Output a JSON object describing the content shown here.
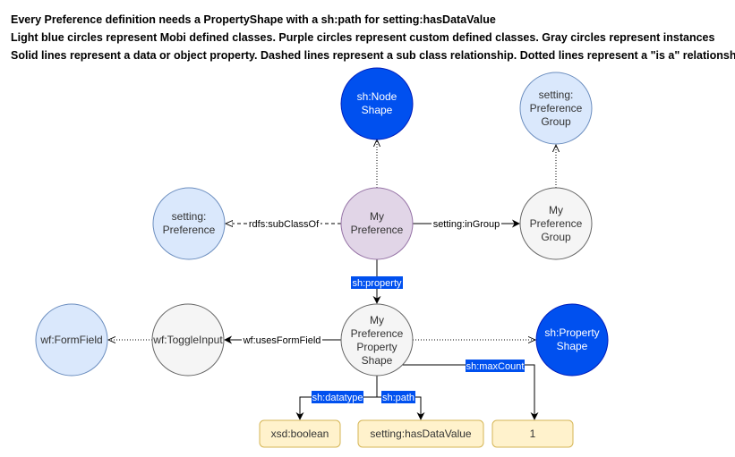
{
  "notes": [
    "Every Preference definition needs a PropertyShape with a sh:path for setting:hasDataValue",
    "Light blue circles represent Mobi defined classes. Purple circles represent custom defined classes. Gray circles represent instances",
    "Solid lines represent a data or object property. Dashed lines represent a sub class relationship. Dotted lines represent a \"is a\" relationship."
  ],
  "colors": {
    "mobi_class_fill": "#dae8fc",
    "mobi_class_stroke": "#6c8ebf",
    "custom_class_fill": "#e1d5e7",
    "custom_class_stroke": "#9673a6",
    "instance_fill": "#f5f5f5",
    "instance_stroke": "#666666",
    "shacl_fill": "#0050ef",
    "shacl_stroke": "#001dbc",
    "literal_fill": "#fff2cc",
    "literal_stroke": "#d6b656",
    "label_highlight": "#0050ef"
  },
  "nodes": {
    "node_shape": [
      "sh:Node",
      "Shape"
    ],
    "preference_group": [
      "setting:",
      "Preference",
      "Group"
    ],
    "setting_preference": [
      "setting:",
      "Preference"
    ],
    "my_preference": [
      "My",
      "Preference"
    ],
    "my_preference_group": [
      "My",
      "Preference",
      "Group"
    ],
    "form_field": [
      "wf:FormField"
    ],
    "toggle_input": [
      "wf:ToggleInput"
    ],
    "my_pref_property_shape": [
      "My",
      "Preference",
      "Property",
      "Shape"
    ],
    "property_shape": [
      "sh:Property",
      "Shape"
    ],
    "xsd_boolean": "xsd:boolean",
    "has_data_value": "setting:hasDataValue",
    "max_count_value": "1"
  },
  "edges": {
    "subclass_of": "rdfs:subClassOf",
    "in_group": "setting:inGroup",
    "property": "sh:property",
    "uses_form_field": "wf:usesFormField",
    "max_count": "sh:maxCount",
    "datatype": "sh:datatype",
    "path": "sh:path"
  }
}
